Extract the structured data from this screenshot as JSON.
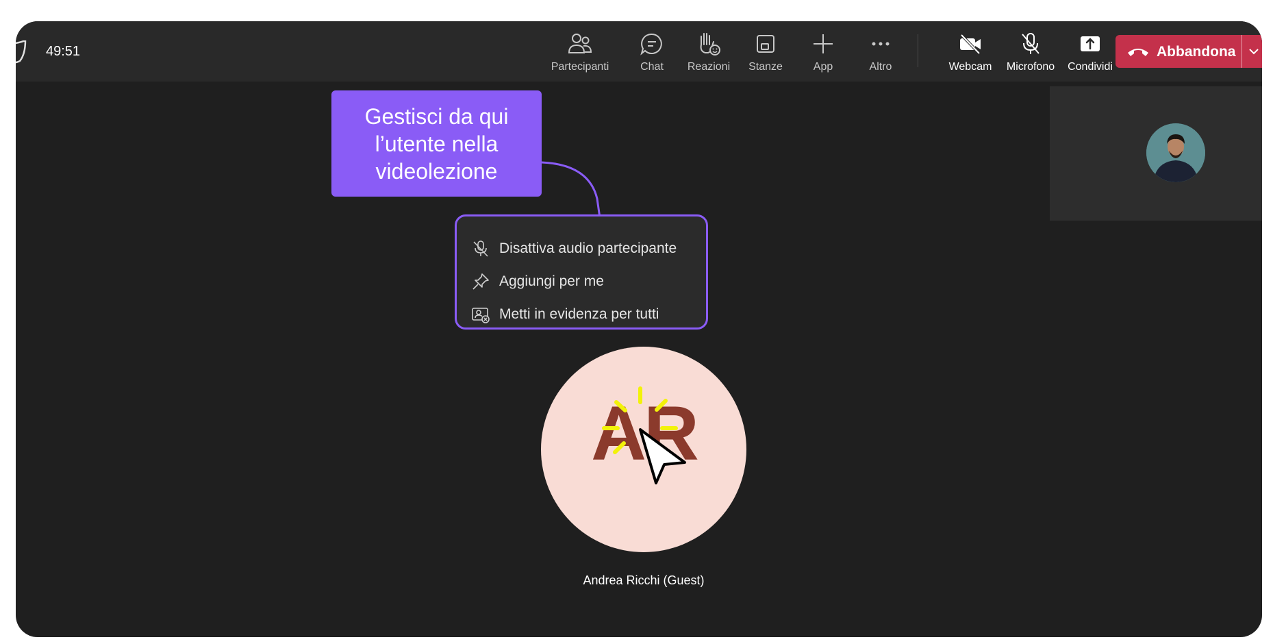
{
  "toolbar": {
    "timer": "49:51",
    "buttons": [
      {
        "label": "Partecipanti",
        "icon": "people-icon"
      },
      {
        "label": "Chat",
        "icon": "chat-icon"
      },
      {
        "label": "Reazioni",
        "icon": "raise-hand-icon"
      },
      {
        "label": "Stanze",
        "icon": "rooms-icon"
      },
      {
        "label": "App",
        "icon": "plus-icon"
      },
      {
        "label": "Altro",
        "icon": "more-icon"
      },
      {
        "label": "Webcam",
        "icon": "camera-off-icon"
      },
      {
        "label": "Microfono",
        "icon": "mic-off-icon"
      },
      {
        "label": "Condividi",
        "icon": "share-screen-icon"
      }
    ],
    "leave_label": "Abbandona"
  },
  "callout": {
    "lines": [
      "Gestisci da qui",
      "l’utente nella",
      "videolezione"
    ]
  },
  "context_menu": {
    "items": [
      {
        "label": "Disattiva audio partecipante",
        "icon": "mic-off-icon"
      },
      {
        "label": "Aggiungi per me",
        "icon": "pin-icon"
      },
      {
        "label": "Metti in evidenza per tutti",
        "icon": "spotlight-icon"
      }
    ]
  },
  "participant": {
    "initials": "AR",
    "name": "Andrea Ricchi (Guest)"
  },
  "colors": {
    "accent": "#8a5cf6",
    "leave": "#c4314b",
    "background": "#1f1f1f",
    "avatar_bg": "#f9dcd5",
    "initials": "#8b3a2c",
    "highlight": "#f2f20a"
  }
}
